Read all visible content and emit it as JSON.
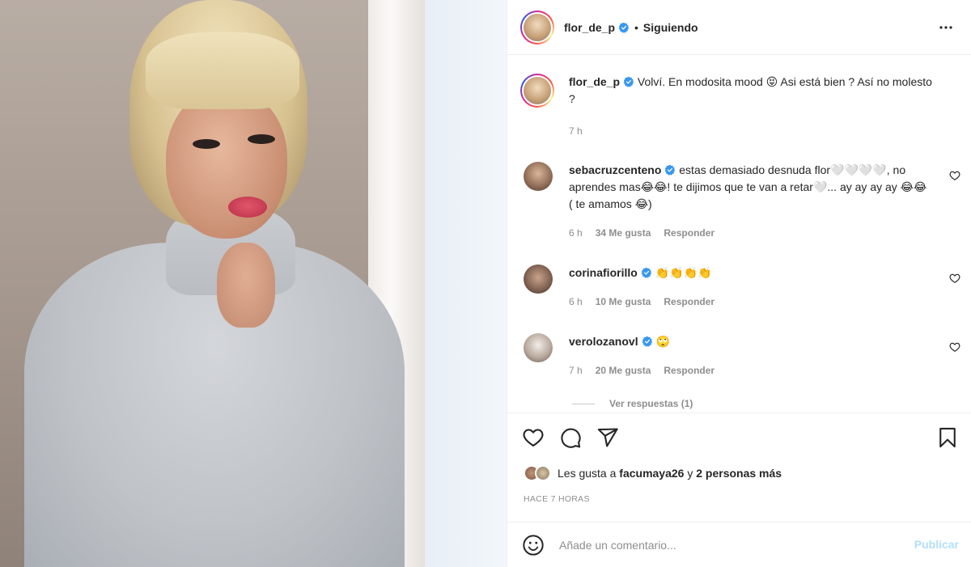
{
  "post": {
    "username": "flor_de_p",
    "separator": "•",
    "follow_status": "Siguiendo",
    "caption_text": "Volví. En modosita mood 😝 Asi está bien ? Así no molesto ?",
    "caption_time": "7 h"
  },
  "comments": [
    {
      "username": "sebacruzcenteno",
      "text": "estas demasiado desnuda flor🤍🤍🤍🤍, no aprendes mas😂😂! te dijimos que te van a retar🤍... ay ay ay ay 😂😂 ( te amamos 😂)",
      "time": "6 h",
      "likes": "34 Me gusta",
      "reply": "Responder"
    },
    {
      "username": "corinafiorillo",
      "text": "👏👏👏👏",
      "time": "6 h",
      "likes": "10 Me gusta",
      "reply": "Responder"
    },
    {
      "username": "verolozanovl",
      "text": "🙄",
      "time": "7 h",
      "likes": "20 Me gusta",
      "reply": "Responder"
    }
  ],
  "view_replies": "Ver respuestas (1)",
  "likes": {
    "prefix": "Les gusta a",
    "user": "facumaya26",
    "connector": "y",
    "others": "2 personas más"
  },
  "posted_ago": "HACE 7 HORAS",
  "composer": {
    "placeholder": "Añade un comentario...",
    "publish_label": "Publicar"
  },
  "colors": {
    "verified": "#3897f0",
    "publish_disabled": "#b2dffc",
    "muted_text": "#8e8e8e"
  },
  "icons": [
    "more-options-icon",
    "verified-badge-icon",
    "heart-icon",
    "comment-icon",
    "share-icon",
    "bookmark-icon",
    "emoji-icon"
  ]
}
